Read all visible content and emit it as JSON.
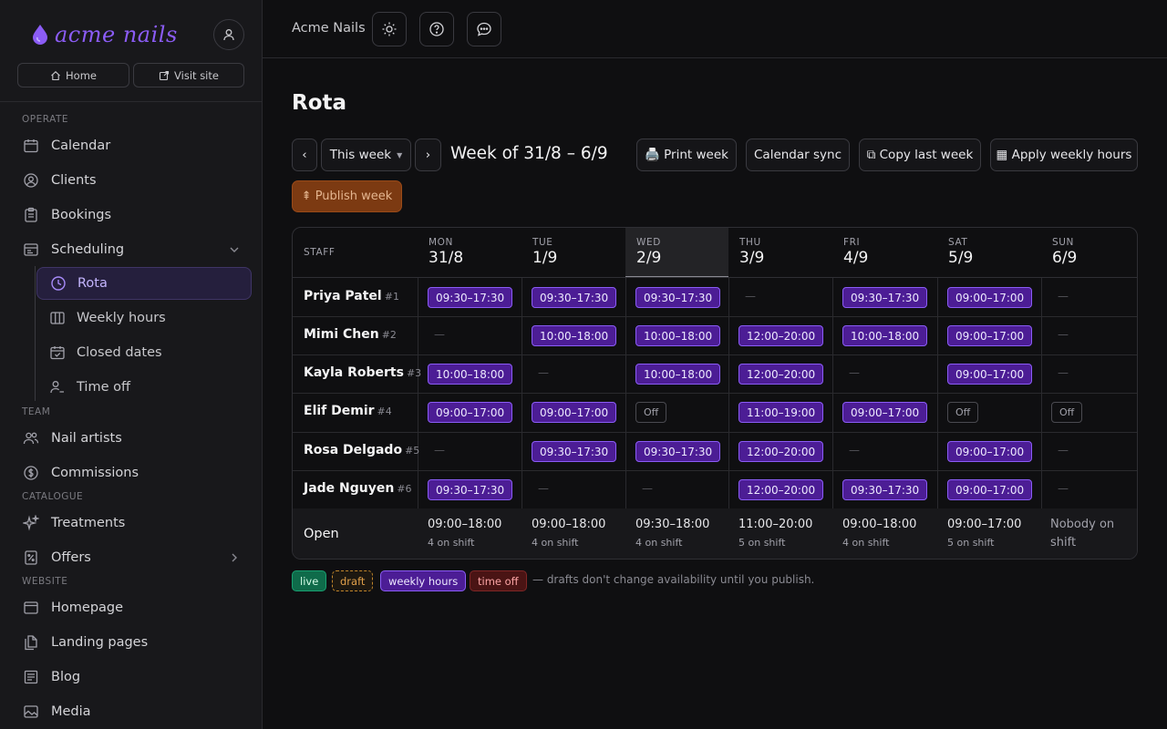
{
  "brand": {
    "name": "acme nails"
  },
  "sidebar": {
    "home_label": "Home",
    "visit_label": "Visit site",
    "sections": {
      "operate": "OPERATE",
      "team": "TEAM",
      "catalogue": "CATALOGUE",
      "website": "WEBSITE"
    },
    "items": {
      "calendar": "Calendar",
      "clients": "Clients",
      "bookings": "Bookings",
      "scheduling": "Scheduling",
      "rota": "Rota",
      "weekly_hours": "Weekly hours",
      "closed_dates": "Closed dates",
      "time_off": "Time off",
      "nail_artists": "Nail artists",
      "commissions": "Commissions",
      "treatments": "Treatments",
      "offers": "Offers",
      "homepage": "Homepage",
      "landing_pages": "Landing pages",
      "blog": "Blog",
      "media": "Media"
    }
  },
  "topbar": {
    "title": "Acme Nails"
  },
  "page": {
    "title": "Rota",
    "week_select": "This week",
    "week_label": "Week of 31/8 – 6/9",
    "prev": "‹",
    "next": "›",
    "print": "🖨️ Print week",
    "sync": "Calendar sync",
    "copy": "⧉ Copy last week",
    "apply": "▦ Apply weekly hours",
    "publish": "⇞ Publish week"
  },
  "table": {
    "staff_header": "STAFF",
    "days": [
      {
        "day": "MON",
        "date": "31/8"
      },
      {
        "day": "TUE",
        "date": "1/9"
      },
      {
        "day": "WED",
        "date": "2/9"
      },
      {
        "day": "THU",
        "date": "3/9"
      },
      {
        "day": "FRI",
        "date": "4/9"
      },
      {
        "day": "SAT",
        "date": "5/9"
      },
      {
        "day": "SUN",
        "date": "6/9"
      }
    ],
    "staff": [
      {
        "name": "Priya Patel",
        "num": "#1",
        "shifts": [
          "09:30–17:30",
          "09:30–17:30",
          "09:30–17:30",
          "—",
          "09:30–17:30",
          "09:00–17:00",
          "—"
        ]
      },
      {
        "name": "Mimi Chen",
        "num": "#2",
        "shifts": [
          "—",
          "10:00–18:00",
          "10:00–18:00",
          "12:00–20:00",
          "10:00–18:00",
          "09:00–17:00",
          "—"
        ]
      },
      {
        "name": "Kayla Roberts",
        "num": "#3",
        "shifts": [
          "10:00–18:00",
          "—",
          "10:00–18:00",
          "12:00–20:00",
          "—",
          "09:00–17:00",
          "—"
        ]
      },
      {
        "name": "Elif Demir",
        "num": "#4",
        "shifts": [
          "09:00–17:00",
          "09:00–17:00",
          "Off",
          "11:00–19:00",
          "09:00–17:00",
          "Off",
          "Off"
        ]
      },
      {
        "name": "Rosa Delgado",
        "num": "#5",
        "shifts": [
          "—",
          "09:30–17:30",
          "09:30–17:30",
          "12:00–20:00",
          "—",
          "09:00–17:00",
          "—"
        ]
      },
      {
        "name": "Jade Nguyen",
        "num": "#6",
        "shifts": [
          "09:30–17:30",
          "—",
          "—",
          "12:00–20:00",
          "09:30–17:30",
          "09:00–17:00",
          "—"
        ]
      }
    ],
    "open_label": "Open",
    "open": [
      {
        "hours": "09:00–18:00",
        "count": "4 on shift"
      },
      {
        "hours": "09:00–18:00",
        "count": "4 on shift"
      },
      {
        "hours": "09:30–18:00",
        "count": "4 on shift"
      },
      {
        "hours": "11:00–20:00",
        "count": "5 on shift"
      },
      {
        "hours": "09:00–18:00",
        "count": "4 on shift"
      },
      {
        "hours": "09:00–17:00",
        "count": "5 on shift"
      }
    ],
    "nobody": "Nobody on shift"
  },
  "legend": {
    "live": "live",
    "draft": "draft",
    "weekly": "weekly hours",
    "off": "time off",
    "note": "— drafts don't change availability until you publish."
  },
  "colors": {
    "accent": "#8b5cf6",
    "shift_bg": "#4c1d95",
    "publish": "#7c3a12",
    "live": "#0f6b4a"
  }
}
